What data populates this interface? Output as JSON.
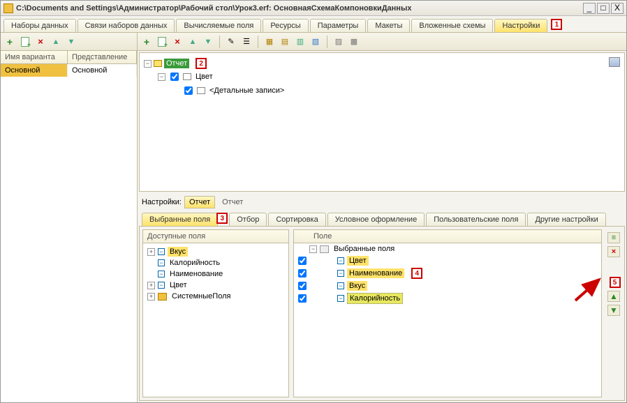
{
  "title": "C:\\Documents and Settings\\Администратор\\Рабочий стол\\Урок3.erf: ОсновнаяСхемаКомпоновкиДанных",
  "mainTabs": {
    "t0": "Наборы данных",
    "t1": "Связи наборов данных",
    "t2": "Вычисляемые поля",
    "t3": "Ресурсы",
    "t4": "Параметры",
    "t5": "Макеты",
    "t6": "Вложенные схемы",
    "t7": "Настройки"
  },
  "markers": {
    "m1": "1",
    "m2": "2",
    "m3": "3",
    "m4": "4",
    "m5": "5"
  },
  "leftGrid": {
    "h1": "Имя варианта",
    "h2": "Представление",
    "r1c1": "Основной",
    "r1c2": "Основной"
  },
  "tree": {
    "root": "Отчет",
    "n1": "Цвет",
    "n2": "<Детальные записи>"
  },
  "settingsRow": {
    "label": "Настройки:",
    "tab": "Отчет",
    "static": "Отчет"
  },
  "subTabs": {
    "s0": "Выбранные поля",
    "s1": "Отбор",
    "s2": "Сортировка",
    "s3": "Условное оформление",
    "s4": "Пользовательские поля",
    "s5": "Другие настройки"
  },
  "available": {
    "header": "Доступные поля",
    "f0": "Вкус",
    "f1": "Калорийность",
    "f2": "Наименование",
    "f3": "Цвет",
    "f4": "СистемныеПоля"
  },
  "selected": {
    "header": "Поле",
    "group": "Выбранные поля",
    "f0": "Цвет",
    "f1": "Наименование",
    "f2": "Вкус",
    "f3": "Калорийность"
  }
}
